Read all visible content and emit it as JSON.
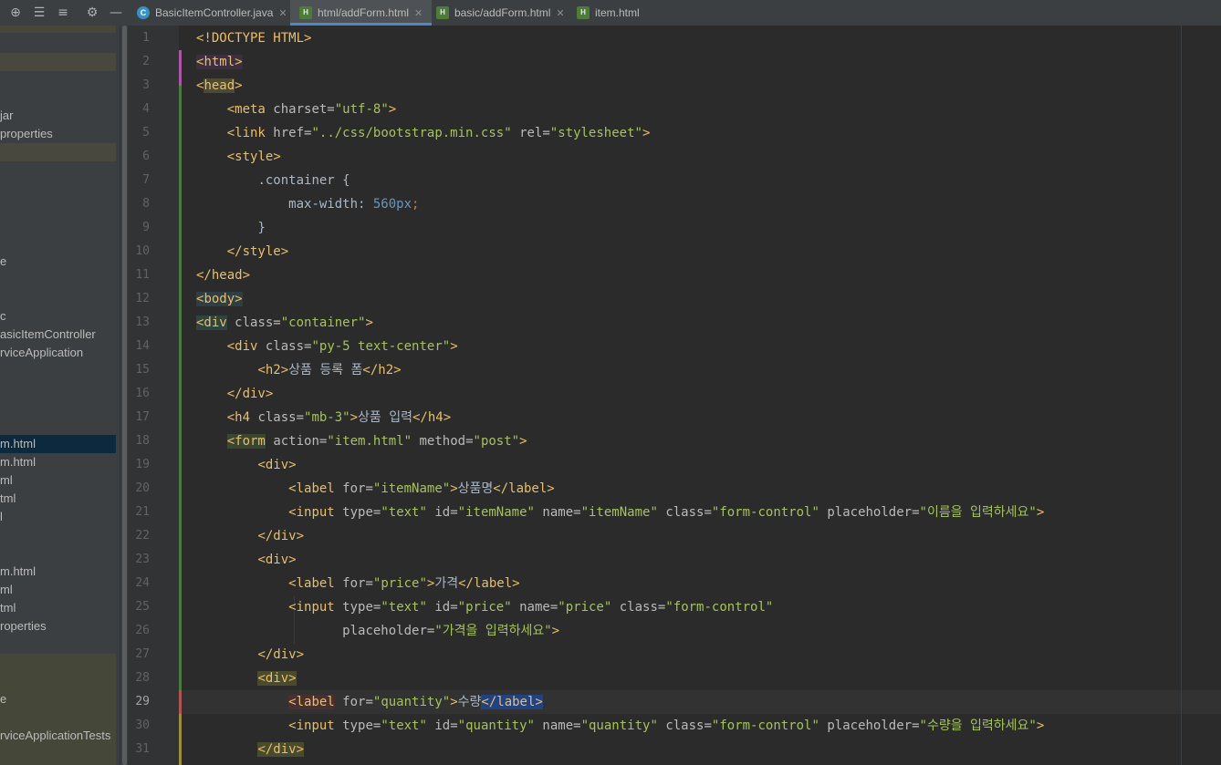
{
  "tabs": [
    {
      "label": "BasicItemController.java",
      "icon": "java-class-icon",
      "active": false
    },
    {
      "label": "html/addForm.html",
      "icon": "html-file-icon",
      "active": true
    },
    {
      "label": "basic/addForm.html",
      "icon": "html-file-icon",
      "active": false
    },
    {
      "label": "item.html",
      "icon": "html-file-icon",
      "active": false
    }
  ],
  "project_rows": [
    {
      "label": "jar"
    },
    {
      "label": "properties"
    },
    {
      "label": "e"
    },
    {
      "label": "c"
    },
    {
      "label": "asicItemController"
    },
    {
      "label": "rviceApplication"
    },
    {
      "label": "m.html"
    },
    {
      "label": "m.html"
    },
    {
      "label": "ml"
    },
    {
      "label": "tml"
    },
    {
      "label": "l"
    },
    {
      "label": "m.html"
    },
    {
      "label": "ml"
    },
    {
      "label": "tml"
    },
    {
      "label": "roperties"
    },
    {
      "label": "e"
    },
    {
      "label": "rviceApplicationTests"
    }
  ],
  "line_numbers": [
    "1",
    "2",
    "3",
    "4",
    "5",
    "6",
    "7",
    "8",
    "9",
    "10",
    "11",
    "12",
    "13",
    "14",
    "15",
    "16",
    "17",
    "18",
    "19",
    "20",
    "21",
    "22",
    "23",
    "24",
    "25",
    "26",
    "27",
    "28",
    "29",
    "30",
    "31"
  ],
  "current_line": 29,
  "code": {
    "l1": "<!DOCTYPE HTML>",
    "html_tag": "html",
    "head_tag": "head",
    "meta_charset": "utf-8",
    "link_href": "../css/bootstrap.min.css",
    "link_rel": "stylesheet",
    "style_tag": "style",
    "css_selector": ".container {",
    "css_prop": "max-width: ",
    "css_num": "560",
    "css_unit": "px",
    "css_close": "}",
    "body_tag": "body",
    "div_container_class": "container",
    "div_center_class": "py-5 text-center",
    "h2_text": "상품 등록 폼",
    "h4_class": "mb-3",
    "h4_text": "상품 입력",
    "form_action": "item.html",
    "form_method": "post",
    "label_itemName_for": "itemName",
    "label_itemName_text": "상품명",
    "input_itemName_type": "text",
    "input_itemName_id": "itemName",
    "input_itemName_name": "itemName",
    "input_itemName_class": "form-control",
    "input_itemName_placeholder": "이름을 입력하세요",
    "label_price_for": "price",
    "label_price_text": "가격",
    "input_price_type": "text",
    "input_price_id": "price",
    "input_price_name": "price",
    "input_price_class": "form-control",
    "input_price_placeholder": "가격을 입력하세요",
    "label_quantity_for": "quantity",
    "label_quantity_text": "수량",
    "input_quantity_type": "text",
    "input_quantity_id": "quantity",
    "input_quantity_name": "quantity",
    "input_quantity_class": "form-control",
    "input_quantity_placeholder": "수량을 입력하세요"
  },
  "colors": {
    "tag": "#e8bf6a",
    "attr_value": "#a5c25c",
    "number": "#6897bb",
    "accent": "#4a88c7"
  }
}
